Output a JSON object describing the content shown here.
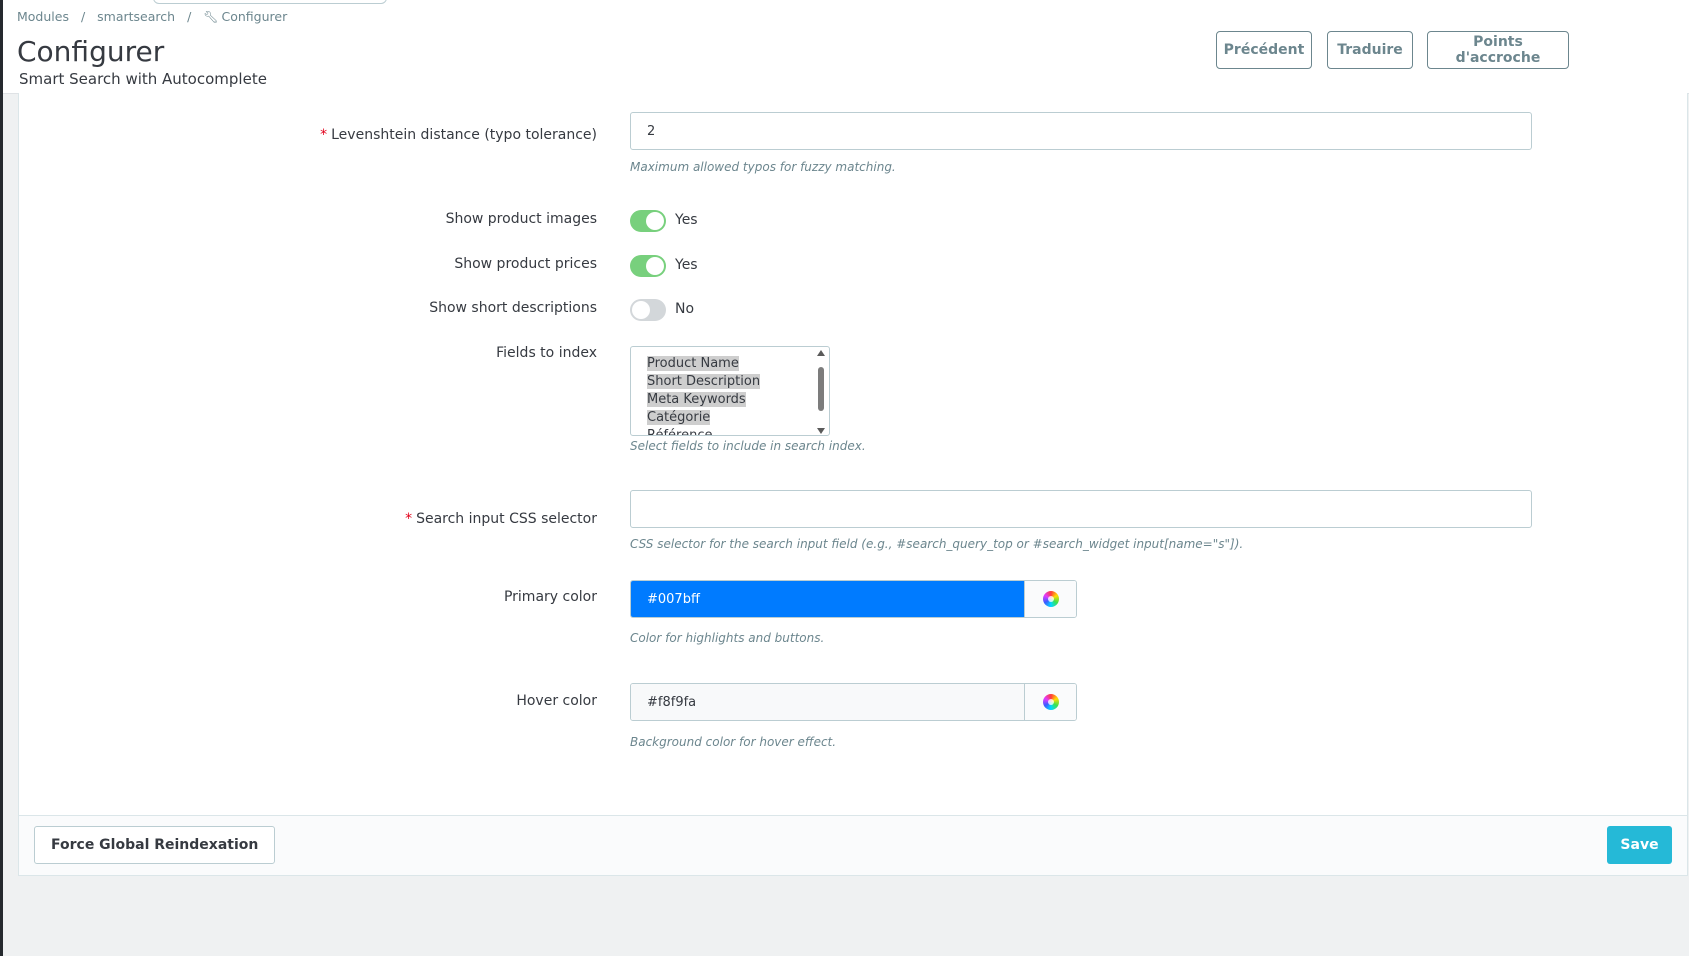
{
  "breadcrumb": {
    "modules": "Modules",
    "module": "smartsearch",
    "current": "Configurer",
    "separator": "/"
  },
  "header": {
    "title": "Configurer",
    "subtitle": "Smart Search with Autocomplete",
    "buttons": {
      "previous": "Précédent",
      "translate": "Traduire",
      "hooks": "Points d'accroche"
    }
  },
  "form": {
    "required_mark": "*",
    "levenshtein": {
      "label": "Levenshtein distance (typo tolerance)",
      "value": "2",
      "help": "Maximum allowed typos for fuzzy matching."
    },
    "show_images": {
      "label": "Show product images",
      "state": "Yes"
    },
    "show_prices": {
      "label": "Show product prices",
      "state": "Yes"
    },
    "show_short_desc": {
      "label": "Show short descriptions",
      "state": "No"
    },
    "fields_to_index": {
      "label": "Fields to index",
      "options": [
        "Product Name",
        "Short Description",
        "Meta Keywords",
        "Catégorie",
        "Référence"
      ],
      "selected": [
        "Product Name",
        "Short Description",
        "Meta Keywords",
        "Catégorie"
      ],
      "help": "Select fields to include in search index."
    },
    "css_selector": {
      "label": "Search input CSS selector",
      "value": "",
      "help": "CSS selector for the search input field (e.g., #search_query_top or #search_widget input[name=\"s\"])."
    },
    "primary_color": {
      "label": "Primary color",
      "value": "#007bff",
      "help": "Color for highlights and buttons."
    },
    "hover_color": {
      "label": "Hover color",
      "value": "#f8f9fa",
      "help": "Background color for hover effect."
    }
  },
  "footer": {
    "reindex": "Force Global Reindexation",
    "save": "Save"
  },
  "colors": {
    "accent": "#25b9d7",
    "switch_on": "#78d07d",
    "required": "#e2001a",
    "primary_swatch": "#007bff",
    "hover_swatch": "#f8f9fa"
  },
  "icons": {
    "breadcrumb": "wrench-icon",
    "color_picker": "color-wheel-icon"
  }
}
